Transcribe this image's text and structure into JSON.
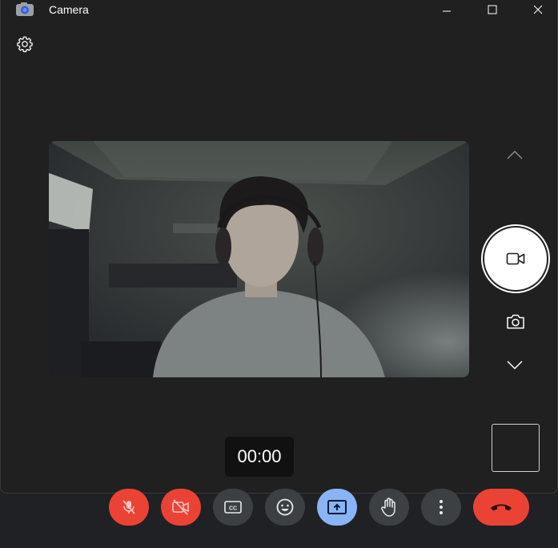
{
  "window": {
    "title": "Camera",
    "controls": [
      "minimize-icon",
      "maximize-icon",
      "close-icon"
    ]
  },
  "toolbar": {
    "settings_icon": "gear-icon"
  },
  "capture": {
    "mode_up_icon": "chevron-up-icon",
    "shutter_icon": "video-camera-icon",
    "photo_mode_icon": "photo-camera-icon",
    "mode_down_icon": "chevron-down-icon",
    "timer": "00:00"
  },
  "callbar": {
    "buttons": [
      {
        "name": "mic-off-icon",
        "state": "off",
        "color": "#ea4335"
      },
      {
        "name": "camera-off-icon",
        "state": "off",
        "color": "#ea4335"
      },
      {
        "name": "captions-icon",
        "color": "#3c4043"
      },
      {
        "name": "emoji-icon",
        "color": "#3c4043"
      },
      {
        "name": "present-screen-icon",
        "color": "#8ab4f8"
      },
      {
        "name": "raise-hand-icon",
        "color": "#3c4043"
      },
      {
        "name": "more-options-icon",
        "color": "#3c4043"
      },
      {
        "name": "hang-up-icon",
        "color": "#ea4335"
      }
    ]
  }
}
